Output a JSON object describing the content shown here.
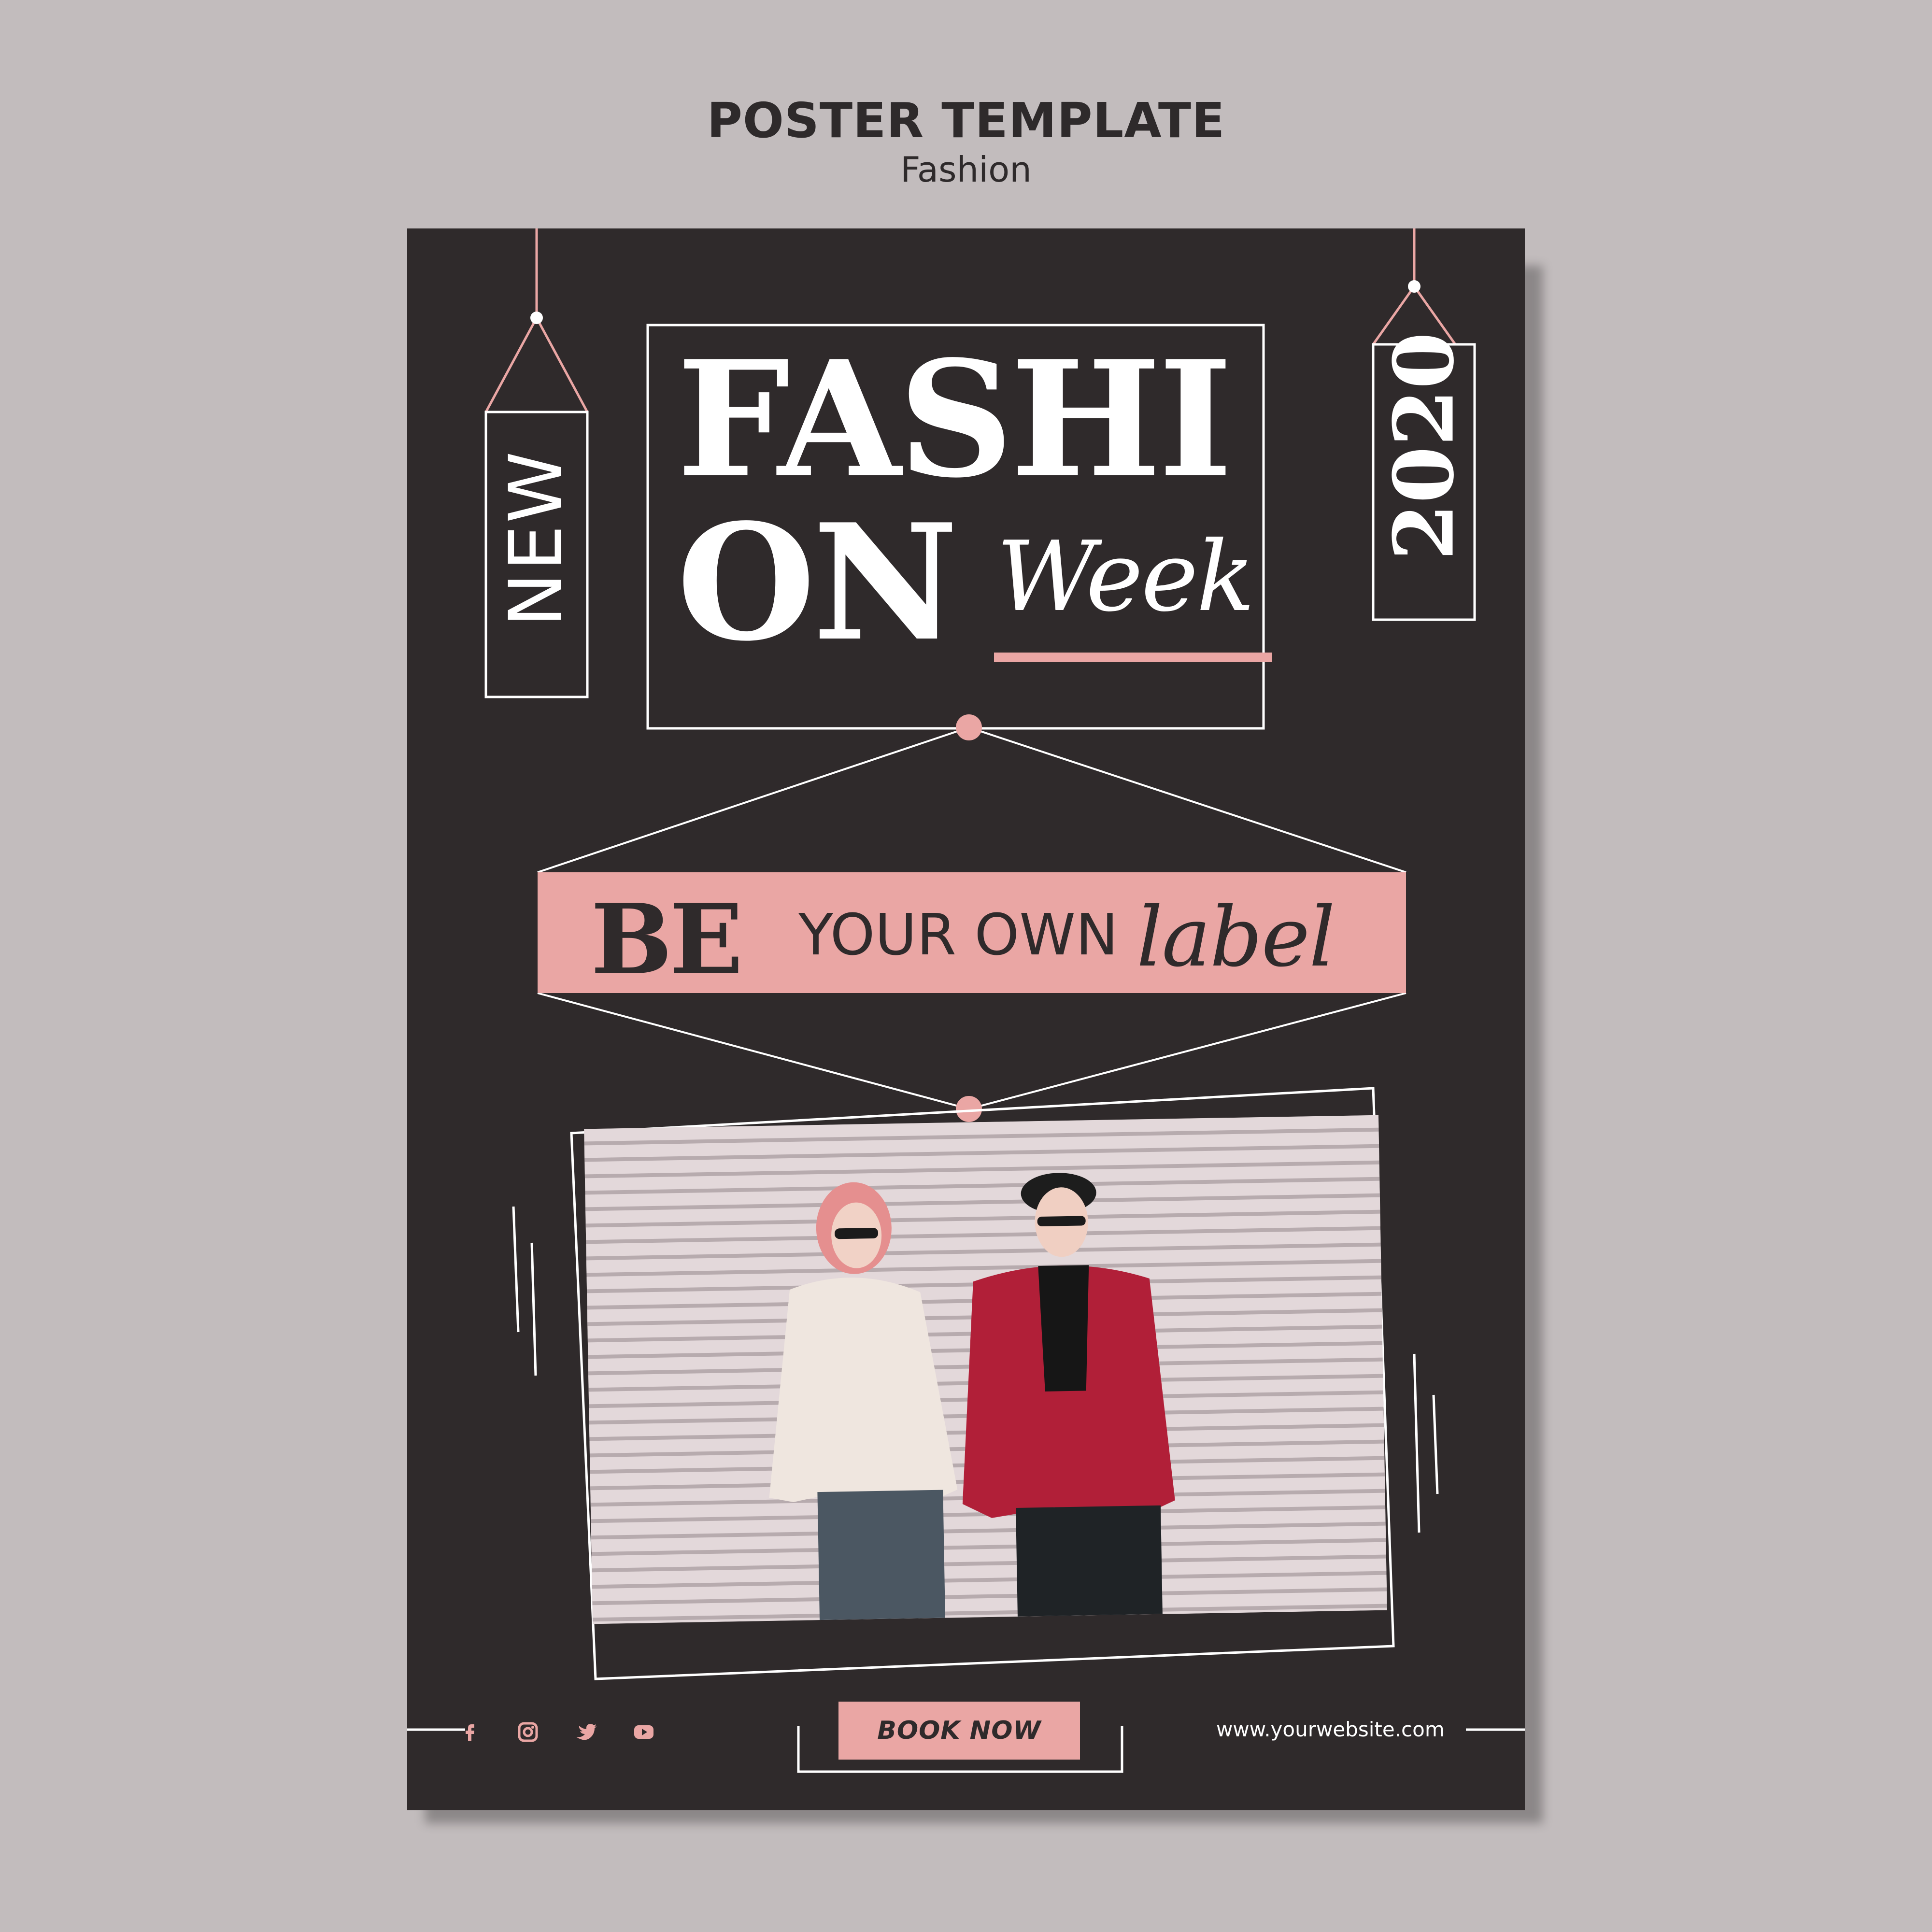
{
  "header": {
    "title": "POSTER TEMPLATE",
    "subtitle": "Fashion"
  },
  "poster": {
    "headline_line1": "FASHI",
    "headline_line2": "ON",
    "headline_script": "Week",
    "left_tag": "NEW",
    "right_tag": "2020",
    "banner": {
      "be": "BE",
      "middle": "YOUR OWN",
      "script": "label"
    },
    "cta_label": "BOOK NOW",
    "website": "www.yourwebsite.com",
    "social_icons": [
      "facebook-icon",
      "instagram-icon",
      "twitter-icon",
      "youtube-icon"
    ]
  },
  "colors": {
    "page_background": "#c2bcbd",
    "poster_background": "#2f2a2b",
    "accent_pink": "#eaa6a4",
    "text_light": "#ffffff"
  }
}
